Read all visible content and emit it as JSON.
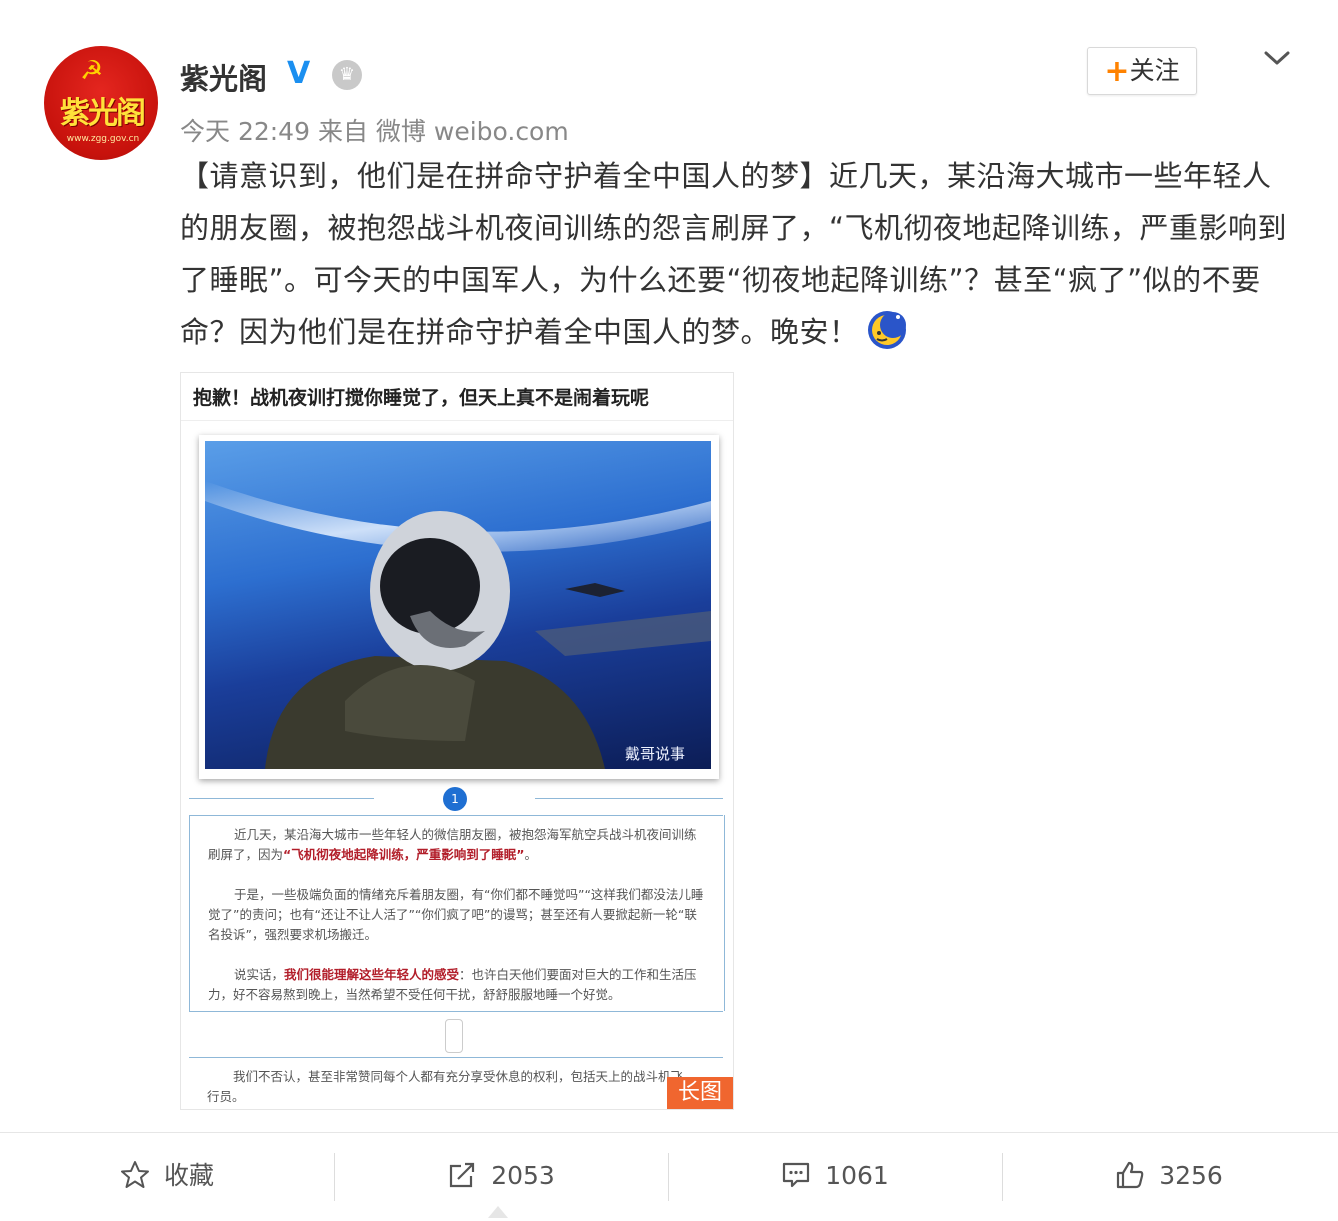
{
  "user": {
    "name": "紫光阁",
    "verified_mark": "V",
    "avatar_text": "紫光阁",
    "avatar_url_text": "www.zgg.gov.cn",
    "timestamp": "今天 22:49",
    "source_prefix": "来自",
    "source": "微博 weibo.com"
  },
  "actions_top": {
    "follow_plus": "+",
    "follow_label": "关注",
    "menu_icon": "chevron-down-icon"
  },
  "post": {
    "text": "【请意识到，他们是在拼命守护着全中国人的梦】近几天，某沿海大城市一些年轻人的朋友圈，被抱怨战斗机夜间训练的怨言刷屏了，“飞机彻夜地起降训练，严重影响到了睡眠”。可今天的中国军人，为什么还要“彻夜地起降训练”？甚至“疯了”似的不要命？因为他们是在拼命守护着全中国人的梦。晚安！",
    "emoji": "moon-emoji-icon"
  },
  "long_image": {
    "header": "抱歉！战机夜训打搅你睡觉了，但天上真不是闹着玩呢",
    "watermark": "戴哥说事",
    "page_number": "1",
    "p1_a": "近几天，某沿海大城市一些年轻人的微信朋友圈，被抱怨海军航空兵战斗机夜间训练刷屏了，因为",
    "p1_hl": "“飞机彻夜地起降训练，严重影响到了睡眠”",
    "p1_b": "。",
    "p2": "于是，一些极端负面的情绪充斥着朋友圈，有“你们都不睡觉吗”“这样我们都没法儿睡觉了”的责问；也有“还让不让人活了”“你们疯了吧”的谩骂；甚至还有人要掀起新一轮“联名投诉”，强烈要求机场搬迁。",
    "p3_a": "说实话，",
    "p3_hl": "我们很能理解这些年轻人的感受",
    "p3_b": "：也许白天他们要面对巨大的工作和生活压力，好不容易熬到晚上，当然希望不受任何干扰，舒舒服服地睡一个好觉。",
    "p4": "我们不否认，甚至非常赞同每个人都有充分享受休息的权利，包括天上的战斗机飞行员。",
    "badge": "长图"
  },
  "footer": {
    "favorite_label": "收藏",
    "repost_count": "2053",
    "comment_count": "1061",
    "like_count": "3256"
  },
  "colors": {
    "accent_orange": "#ff8200",
    "verified_blue": "#1b8ff0",
    "badge_orange": "#f0662f"
  }
}
